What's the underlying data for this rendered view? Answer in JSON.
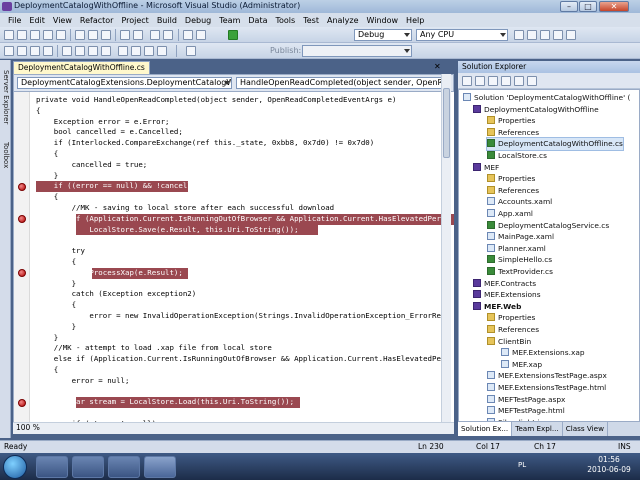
{
  "window": {
    "title": "DeploymentCatalogWithOffline - Microsoft Visual Studio (Administrator)",
    "minimize": "–",
    "maximize": "□",
    "close": "✕"
  },
  "menu": [
    "File",
    "Edit",
    "View",
    "Refactor",
    "Project",
    "Build",
    "Debug",
    "Team",
    "Data",
    "Tools",
    "Test",
    "Analyze",
    "Window",
    "Help"
  ],
  "toolbar": {
    "config": "Debug",
    "platform": "Any CPU",
    "publish_label": "Publish:"
  },
  "side_tabs": [
    "Server Explorer",
    "Toolbox"
  ],
  "editor": {
    "tab": "DeploymentCatalogWithOffline.cs",
    "nav_class": "DeploymentCatalogExtensions.DeploymentCatalogWithOff",
    "nav_member": "HandleOpenReadCompleted(object sender, OpenReadCom",
    "zoom": "100 %",
    "lines": [
      "private void HandleOpenReadCompleted(object sender, OpenReadCompletedEventArgs e)",
      "{",
      "    Exception error = e.Error;",
      "    bool cancelled = e.Cancelled;",
      "    if (Interlocked.CompareExchange(ref this._state, 0xbb8, 0x7d0) != 0x7d0)",
      "    {",
      "        cancelled = true;",
      "    }",
      "    if ((error == null) && !cancelled)",
      "    {",
      "        //MK - saving to local store after each successful download",
      "        if (Application.Current.IsRunningOutOfBrowser && Application.Current.HasElevatedPerm",
      "            LocalStore.Save(e.Result, this.Uri.ToString());",
      "",
      "        try",
      "        {",
      "            ProcessXap(e.Result);",
      "        }",
      "        catch (Exception exception2)",
      "        {",
      "            error = new InvalidOperationException(Strings.InvalidOperationException_ErrorRea",
      "        }",
      "    }",
      "    //MK - attempt to load .xap file from local store",
      "    else if (Application.Current.IsRunningOutOfBrowser && Application.Current.HasElevatedPer",
      "    {",
      "        error = null;",
      "",
      "        var stream = LocalStore.Load(this.Uri.ToString());",
      "",
      "        if (stream != null)",
      "        {"
    ]
  },
  "solution_explorer": {
    "title": "Solution Explorer",
    "items": [
      "Solution 'DeploymentCatalogWithOffline' (",
      "DeploymentCatalogWithOffline",
      "Properties",
      "References",
      "DeploymentCatalogWithOffline.cs",
      "LocalStore.cs",
      "MEF",
      "Properties",
      "References",
      "Accounts.xaml",
      "App.xaml",
      "DeploymentCatalogService.cs",
      "MainPage.xaml",
      "Planner.xaml",
      "SimpleHello.cs",
      "TextProvider.cs",
      "MEF.Contracts",
      "MEF.Extensions",
      "MEF.Web",
      "Properties",
      "References",
      "ClientBin",
      "MEF.Extensions.xap",
      "MEF.xap",
      "MEF.ExtensionsTestPage.aspx",
      "MEF.ExtensionsTestPage.html",
      "MEFTestPage.aspx",
      "MEFTestPage.html",
      "Silverlight.js"
    ],
    "tabs": [
      "Solution Ex...",
      "Team Expl...",
      "Class View"
    ]
  },
  "status": {
    "ready": "Ready",
    "ln": "Ln 230",
    "col": "Col 17",
    "ch": "Ch 17",
    "ins": "INS"
  },
  "taskbar": {
    "lang": "PL",
    "time": "01:56",
    "date": "2010-06-09"
  }
}
